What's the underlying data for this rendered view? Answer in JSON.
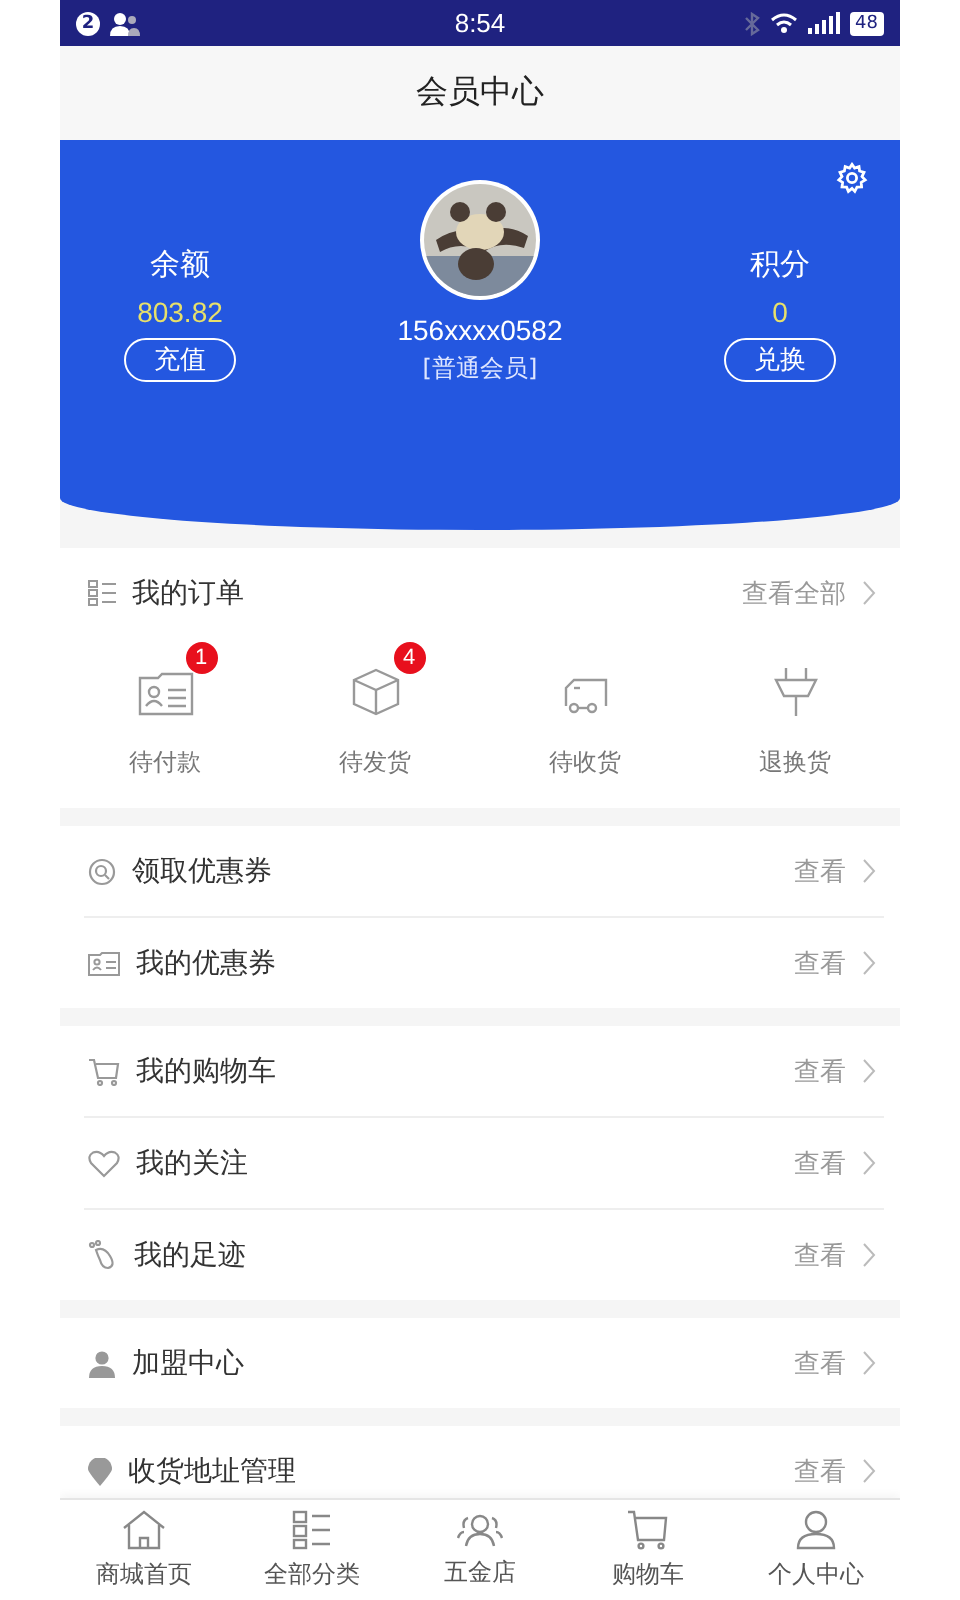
{
  "status_bar": {
    "notification_count": "2",
    "time": "8:54",
    "battery": "48"
  },
  "header": {
    "title": "会员中心"
  },
  "profile": {
    "balance": {
      "label": "余额",
      "value": "803.82",
      "button": "充值"
    },
    "phone": "156xxxx0582",
    "member_level": "[普通会员]",
    "points": {
      "label": "积分",
      "value": "0",
      "button": "兑换"
    }
  },
  "orders": {
    "title": "我的订单",
    "link": "查看全部",
    "items": [
      {
        "kind": "payment",
        "label": "待付款",
        "badge": "1"
      },
      {
        "kind": "box",
        "label": "待发货",
        "badge": "4"
      },
      {
        "kind": "truck",
        "label": "待收货"
      },
      {
        "kind": "plug",
        "label": "退换货"
      }
    ]
  },
  "sections": [
    [
      {
        "kind": "coupon-search",
        "label": "领取优惠券",
        "link": "查看"
      },
      {
        "kind": "coupon-card",
        "label": "我的优惠券",
        "link": "查看"
      }
    ],
    [
      {
        "kind": "cart",
        "label": "我的购物车",
        "link": "查看"
      },
      {
        "kind": "heart",
        "label": "我的关注",
        "link": "查看"
      },
      {
        "kind": "footprint",
        "label": "我的足迹",
        "link": "查看"
      }
    ],
    [
      {
        "kind": "person",
        "label": "加盟中心",
        "link": "查看"
      }
    ],
    [
      {
        "kind": "pin",
        "label": "收货地址管理",
        "link": "查看"
      }
    ]
  ],
  "tab_bar": [
    {
      "kind": "home",
      "label": "商城首页"
    },
    {
      "kind": "grid",
      "label": "全部分类"
    },
    {
      "kind": "people",
      "label": "五金店"
    },
    {
      "kind": "cart",
      "label": "购物车"
    },
    {
      "kind": "person",
      "label": "个人中心"
    }
  ]
}
